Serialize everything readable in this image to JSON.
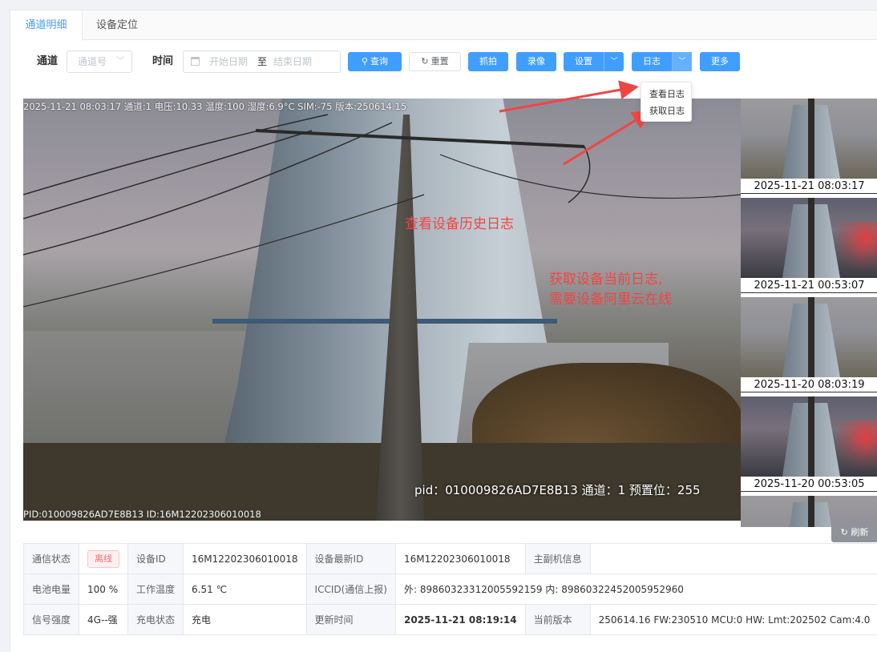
{
  "tabs": [
    {
      "label": "通道明细",
      "active": true
    },
    {
      "label": "设备定位",
      "active": false
    }
  ],
  "filters": {
    "channel_label": "通道",
    "channel_placeholder": "通道号",
    "time_label": "时间",
    "start_placeholder": "开始日期",
    "range_sep": "至",
    "end_placeholder": "结束日期"
  },
  "toolbar": {
    "query": "查询",
    "reset": "重置",
    "capture": "抓拍",
    "record": "录像",
    "settings": "设置",
    "log": "日志",
    "more": "更多"
  },
  "log_menu": {
    "items": [
      "查看日志",
      "获取日志"
    ]
  },
  "viewer": {
    "osd_top": "2025-11-21 08:03:17 通道:1 电压:10.33 温度:100 湿度:6.9°C SIM:-75 版本:250614.15",
    "osd_pid": "pid：010009826AD7E8B13 通道：1 预置位：255",
    "osd_bottom": "PID:010009826AD7E8B13 ID:16M12202306010018"
  },
  "annotations": {
    "view_log": "查看设备历史日志",
    "get_log_line1": "获取设备当前日志,",
    "get_log_line2": "需要设备阿里云在线",
    "color": "#f04545"
  },
  "thumbnails": [
    {
      "time": "2025-11-21 08:03:17",
      "scene": "day"
    },
    {
      "time": "2025-11-21 00:53:07",
      "scene": "night"
    },
    {
      "time": "2025-11-20 08:03:19",
      "scene": "day"
    },
    {
      "time": "2025-11-20 00:53:05",
      "scene": "night"
    }
  ],
  "refresh_label": "刷新",
  "info": {
    "comm_status_label": "通信状态",
    "comm_status_value": "离线",
    "device_id_label": "设备ID",
    "device_id_value": "16M12202306010018",
    "latest_id_label": "设备最新ID",
    "latest_id_value": "16M12202306010018",
    "host_info_label": "主副机信息",
    "host_info_value": "",
    "battery_label": "电池电量",
    "battery_value": "100 %",
    "temp_label": "工作温度",
    "temp_value": "6.51 ℃",
    "iccid_label": "ICCID(通信上报)",
    "iccid_value": "外:  89860323312005592159 内:  89860322452005952960",
    "signal_label": "信号强度",
    "signal_value": "4G--强",
    "charge_label": "充电状态",
    "charge_value": "充电",
    "update_label": "更新时间",
    "update_value": "2025-11-21 08:19:14",
    "version_label": "当前版本",
    "version_value": "250614.16 FW:230510 MCU:0 HW: Lmt:202502 Cam:4.0"
  },
  "colors": {
    "primary": "#409eff",
    "offline": "#f56c6c",
    "update_time": "#e02020"
  }
}
